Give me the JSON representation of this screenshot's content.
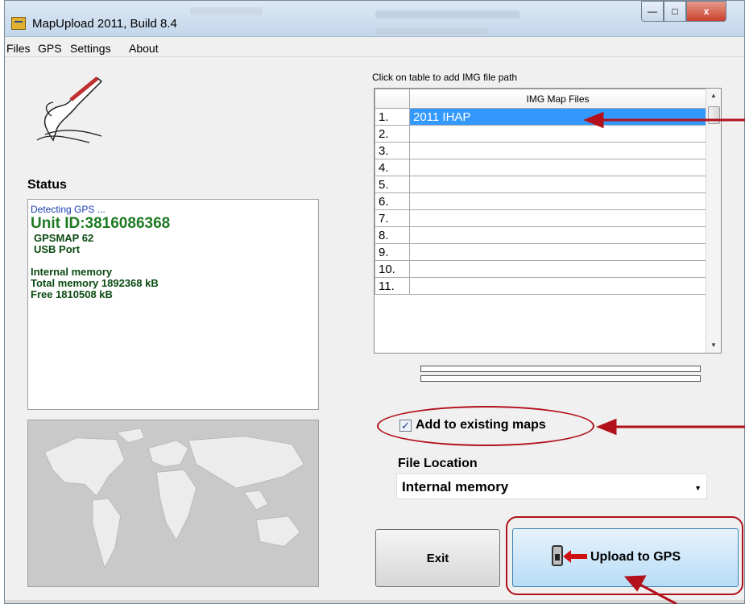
{
  "window": {
    "title": "MapUpload 2011, Build 8.4",
    "controls": {
      "minimize": "—",
      "maximize": "□",
      "close": "x"
    }
  },
  "menu": {
    "items": [
      "Files",
      "GPS",
      "Settings",
      "About"
    ]
  },
  "status": {
    "heading": "Status",
    "lines": {
      "detecting": "Detecting GPS ...",
      "unit_id": "Unit ID:3816086368",
      "model": "GPSMAP 62",
      "port": "USB Port",
      "memory_type": "Internal memory",
      "total_memory": "Total memory 1892368 kB",
      "free_memory": "Free 1810508 kB"
    }
  },
  "files": {
    "hint": "Click on table to add IMG file path",
    "column_header": "IMG Map Files",
    "rows": [
      {
        "num": "1.",
        "file": "2011 IHAP",
        "selected": true
      },
      {
        "num": "2.",
        "file": ""
      },
      {
        "num": "3.",
        "file": ""
      },
      {
        "num": "4.",
        "file": ""
      },
      {
        "num": "5.",
        "file": ""
      },
      {
        "num": "6.",
        "file": ""
      },
      {
        "num": "7.",
        "file": ""
      },
      {
        "num": "8.",
        "file": ""
      },
      {
        "num": "9.",
        "file": ""
      },
      {
        "num": "10.",
        "file": ""
      },
      {
        "num": "11.",
        "file": ""
      }
    ]
  },
  "options": {
    "add_existing_label": "Add to existing maps",
    "add_existing_checked": true,
    "file_location_label": "File Location",
    "file_location_value": "Internal memory"
  },
  "buttons": {
    "exit": "Exit",
    "upload": "Upload to GPS"
  },
  "colors": {
    "selection": "#3399ff",
    "status_green": "#1d7a22",
    "status_blue": "#1a3cb4",
    "annotation_red": "#b2101a",
    "upload_button": "#b8dcf6"
  },
  "icons": {
    "app": "app-icon",
    "signature": "signature-pen-icon",
    "device": "gps-device-icon",
    "world_map": "world-map-image"
  }
}
